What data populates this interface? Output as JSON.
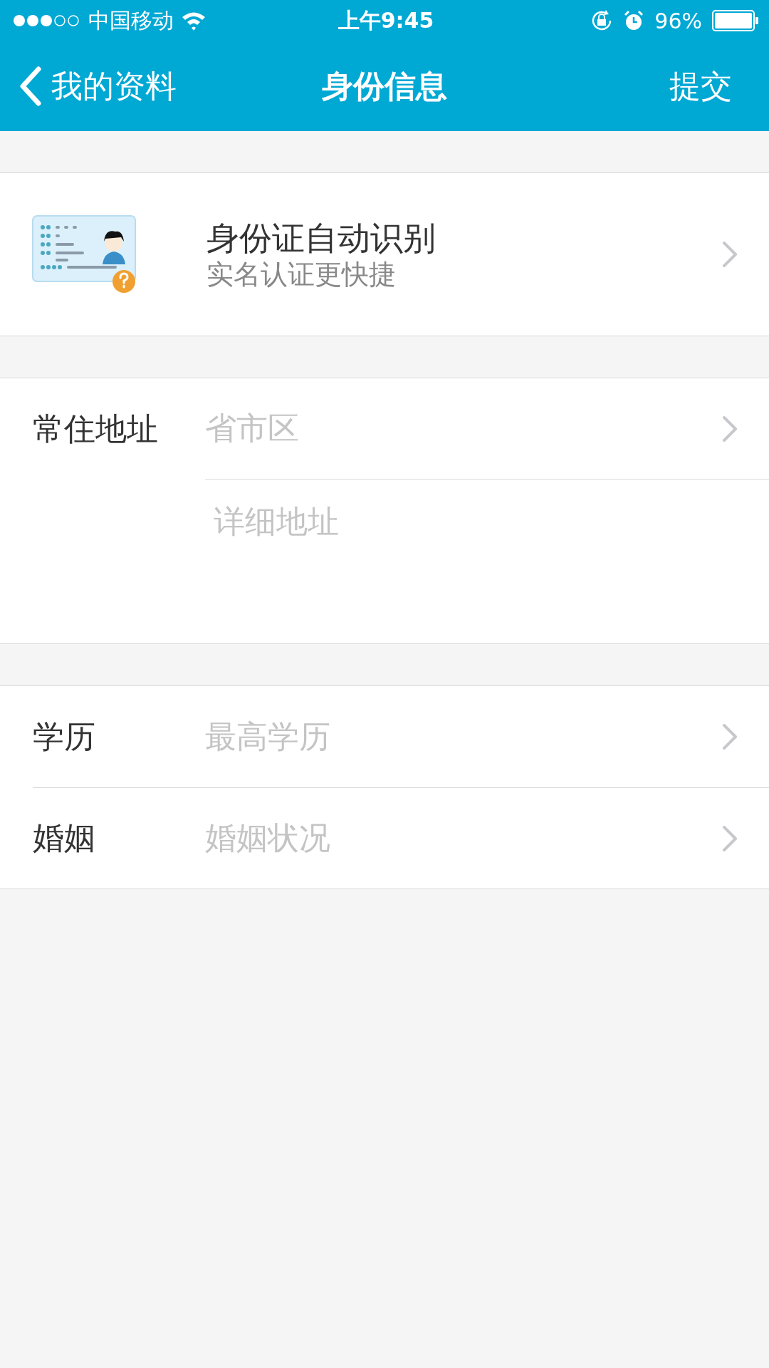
{
  "status_bar": {
    "carrier": "中国移动",
    "time": "上午9:45",
    "battery": "96%"
  },
  "nav_bar": {
    "back": "我的资料",
    "title": "身份信息",
    "action": "提交"
  },
  "id_scan": {
    "title": "身份证自动识别",
    "subtitle": "实名认证更快捷"
  },
  "address": {
    "label": "常住地址",
    "region_placeholder": "省市区",
    "detail_placeholder": "详细地址"
  },
  "fields": [
    {
      "label": "学历",
      "placeholder": "最高学历"
    },
    {
      "label": "婚姻",
      "placeholder": "婚姻状况"
    }
  ]
}
